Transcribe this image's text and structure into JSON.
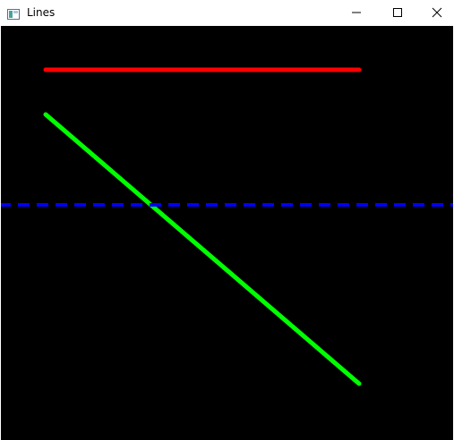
{
  "window": {
    "title": "Lines"
  },
  "icons": {
    "app": "window-app-icon",
    "minimize": "minimize-icon",
    "maximize": "maximize-icon",
    "close": "close-icon"
  },
  "lines": [
    {
      "name": "red-line",
      "color": "#ff0000",
      "style": "solid"
    },
    {
      "name": "green-line",
      "color": "#00ff00",
      "style": "solid"
    },
    {
      "name": "blue-line",
      "color": "#0000ff",
      "style": "dashed"
    }
  ]
}
